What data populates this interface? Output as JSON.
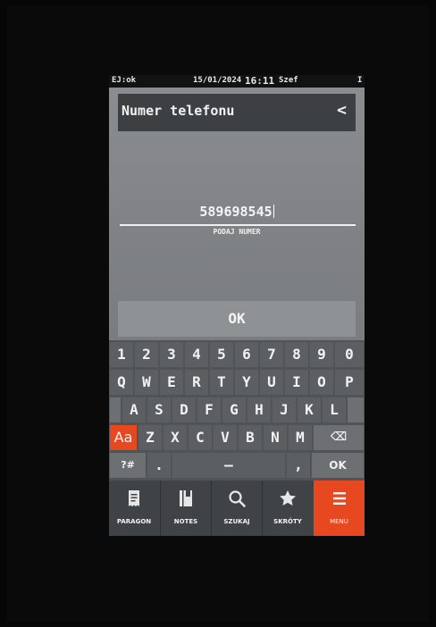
{
  "status_bar": {
    "left": "EJ:ok",
    "date": "15/01/2024",
    "time": "16:11",
    "user": "Szef",
    "right": "I"
  },
  "header": {
    "title": "Numer telefonu",
    "back_glyph": "<"
  },
  "input": {
    "value": "589698545",
    "hint": "PODAJ NUMER"
  },
  "ok_button": {
    "label": "OK"
  },
  "keyboard": {
    "digits": [
      "1",
      "2",
      "3",
      "4",
      "5",
      "6",
      "7",
      "8",
      "9",
      "0"
    ],
    "row1": [
      "Q",
      "W",
      "E",
      "R",
      "T",
      "Y",
      "U",
      "I",
      "O",
      "P"
    ],
    "row2": [
      "A",
      "S",
      "D",
      "F",
      "G",
      "H",
      "J",
      "K",
      "L"
    ],
    "row3": [
      "Z",
      "X",
      "C",
      "V",
      "B",
      "N",
      "M"
    ],
    "case_key": "Aa",
    "backspace_glyph": "⌫",
    "sym_key": "?#",
    "dot_key": ".",
    "space_glyph": "—",
    "comma_key": ",",
    "ok_key": "OK"
  },
  "bottom_nav": [
    {
      "label": "PARAGON",
      "icon": "receipt-icon"
    },
    {
      "label": "NOTES",
      "icon": "notebook-icon"
    },
    {
      "label": "SZUKAJ",
      "icon": "search-icon"
    },
    {
      "label": "SKRÓTY",
      "icon": "star-icon"
    },
    {
      "label": "MENU",
      "icon": "menu-icon",
      "active": true
    }
  ],
  "colors": {
    "accent": "#e8481f",
    "screen_bg": "#7f8284",
    "keyboard_bg": "#505456",
    "nav_bg": "#3f4346"
  }
}
